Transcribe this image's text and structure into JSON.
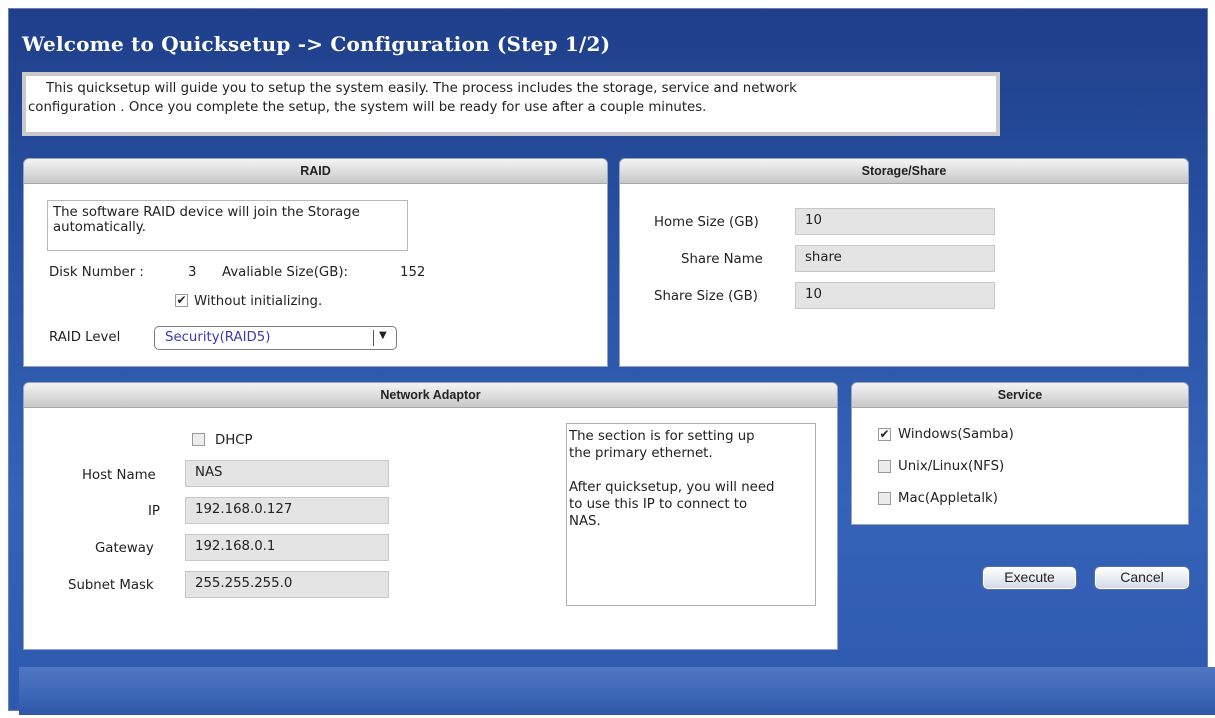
{
  "title": "Welcome to Quicksetup -> Configuration (Step 1/2)",
  "intro": {
    "line1": "This quicksetup will guide you to setup the system easily. The process includes the storage, service and network",
    "line2": "configuration . Once you complete the setup, the system will be ready for use after a couple minutes."
  },
  "raid": {
    "header": "RAID",
    "note": "The software RAID device will join the Storage automatically.",
    "disk_number_label": "Disk Number :",
    "disk_number_value": "3",
    "available_size_label": "Avaliable Size(GB):",
    "available_size_value": "152",
    "without_init_label": "Without initializing.",
    "without_init_checked": true,
    "raid_level_label": "RAID Level",
    "raid_level_value": "Security(RAID5)",
    "dropdown_arrow": "▼"
  },
  "storage": {
    "header": "Storage/Share",
    "home_size_label": "Home Size (GB)",
    "home_size_value": "10",
    "share_name_label": "Share Name",
    "share_name_value": "share",
    "share_size_label": "Share Size (GB)",
    "share_size_value": "10"
  },
  "network": {
    "header": "Network Adaptor",
    "dhcp_label": "DHCP",
    "dhcp_checked": false,
    "host_name_label": "Host Name",
    "host_name_value": "NAS",
    "ip_label": "IP",
    "ip_value": "192.168.0.127",
    "gateway_label": "Gateway",
    "gateway_value": "192.168.0.1",
    "subnet_label": "Subnet Mask",
    "subnet_value": "255.255.255.0",
    "help_line1": "The section is for setting up",
    "help_line2": "the primary ethernet.",
    "help_line3": "After quicksetup, you will need",
    "help_line4": "to use this IP to connect to",
    "help_line5": "NAS."
  },
  "service": {
    "header": "Service",
    "items": [
      {
        "label": "Windows(Samba)",
        "checked": true
      },
      {
        "label": "Unix/Linux(NFS)",
        "checked": false
      },
      {
        "label": "Mac(Appletalk)",
        "checked": false
      }
    ]
  },
  "buttons": {
    "execute": "Execute",
    "cancel": "Cancel"
  },
  "glyphs": {
    "check": "✔"
  },
  "colors": {
    "background": "#2a55a8",
    "title_text": "#ffffff",
    "select_text": "#3a3ab0"
  }
}
